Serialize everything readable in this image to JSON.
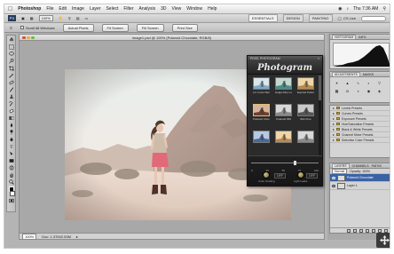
{
  "menubar": {
    "app": "Photoshop",
    "items": [
      "File",
      "Edit",
      "Image",
      "Layer",
      "Select",
      "Filter",
      "Analysis",
      "3D",
      "View",
      "Window",
      "Help"
    ],
    "clock": "Thu 7:36 AM"
  },
  "appbar": {
    "zoom": "100%",
    "workspaces": [
      "ESSENTIALS",
      "DESIGN",
      "PAINTING"
    ],
    "cs_live": "CS Live"
  },
  "options": {
    "scroll_all": "Scroll All Windows",
    "actual_pixels": "Actual Pixels",
    "fit_screen": "Fit Screen",
    "fill_screen": "Fill Screen",
    "print_size": "Print Size"
  },
  "document": {
    "tab_title": "image1.psd @ 100% (Polaroid Chocolate, RGB/8)",
    "zoom": "100%",
    "doc_info": "Doc: 1.37M/2.53M"
  },
  "plugin": {
    "header": "PIXEL PHOTOGRAM",
    "title": "Photogram",
    "presets": [
      {
        "name": "LC Cross Warm",
        "tone": "cool"
      },
      {
        "name": "Holga Dirty Low",
        "tone": "teal"
      },
      {
        "name": "Expired Polaroid",
        "tone": "warm"
      },
      {
        "name": "Polaroid Chocolate",
        "tone": "choc"
      },
      {
        "name": "Polaroid 669",
        "tone": "mid"
      },
      {
        "name": "Bob Fine",
        "tone": "mono"
      },
      {
        "name": "",
        "tone": "blue"
      },
      {
        "name": "",
        "tone": "warm"
      },
      {
        "name": "",
        "tone": "mid"
      }
    ],
    "slider_ticks": [
      "0",
      "25",
      "50",
      "75",
      "100"
    ],
    "slider_value": 0.62,
    "off_label": "OFF",
    "knob_left_label": "Color Grading",
    "knob_right_label": "Light Leaks"
  },
  "panels": {
    "histogram_tabs": [
      "HISTOGRAM",
      "INFO"
    ],
    "adjust_tabs": [
      "ADJUSTMENTS",
      "MASKS"
    ],
    "preset_rows": [
      "Levels Presets",
      "Curves Presets",
      "Exposure Presets",
      "Hue/Saturation Presets",
      "Black & White Presets",
      "Channel Mixer Presets",
      "Selective Color Presets"
    ],
    "layers_tabs": [
      "LAYERS",
      "CHANNELS",
      "PATHS"
    ],
    "blend_mode": "Normal",
    "opacity": "Opacity: 100%",
    "layers": [
      {
        "name": "Polaroid Chocolate",
        "active": true
      },
      {
        "name": "Layer 1",
        "active": false
      }
    ]
  },
  "colors": {
    "frame_bg": "#b4b4b4",
    "plugin_bg": "#2b2b2b",
    "layer_active": "#3c62a4"
  }
}
